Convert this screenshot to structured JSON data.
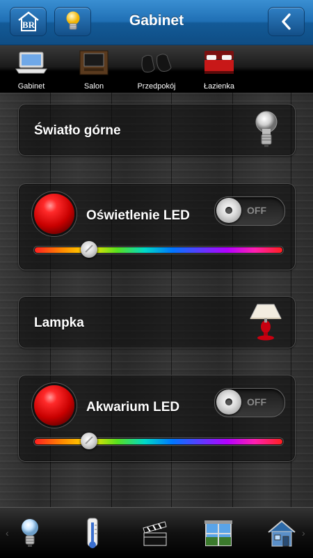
{
  "header": {
    "title": "Gabinet",
    "logo_icon": "home-logo-icon",
    "bulb_icon": "lightbulb-icon",
    "back_icon": "chevron-left-icon",
    "color": "#1f6fb4"
  },
  "rooms": [
    {
      "label": "Gabinet",
      "icon": "laptop-icon"
    },
    {
      "label": "Salon",
      "icon": "tv-icon"
    },
    {
      "label": "Przedpokój",
      "icon": "shoes-icon"
    },
    {
      "label": "Łazienka",
      "icon": "bed-icon"
    }
  ],
  "controls": {
    "swiatlo": {
      "label": "Światło górne",
      "icon": "lightbulb-icon"
    },
    "oswietlenie": {
      "label": "Oświetlenie LED",
      "toggle": "OFF",
      "slider_fraction": 0.22
    },
    "lampka": {
      "label": "Lampka",
      "icon": "table-lamp-icon"
    },
    "akwarium": {
      "label": "Akwarium LED",
      "toggle": "OFF",
      "slider_fraction": 0.22
    }
  },
  "footer": {
    "left_arrow": "‹",
    "right_arrow": "›",
    "items": [
      "lightbulb-icon",
      "thermometer-icon",
      "clapperboard-icon",
      "window-blinds-icon",
      "house-icon"
    ]
  }
}
